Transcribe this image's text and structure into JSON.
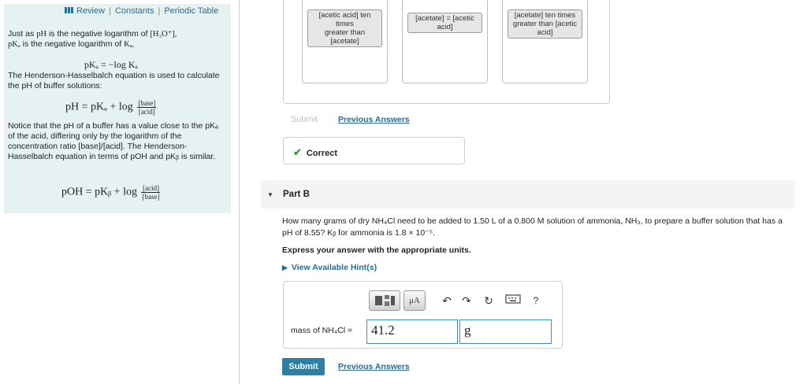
{
  "left_panel": {
    "links": {
      "review": "Review",
      "constants": "Constants",
      "periodic_table": "Periodic Table"
    },
    "para1_line1_a": "Just as",
    "para1_line1_b": "pH",
    "para1_line1_c": "is the negative logarithm of",
    "para1_line1_d": "[H₃O⁺],",
    "para1_line2_a": "pKₐ",
    "para1_line2_b": "is the negative logarithm of",
    "para1_line2_c": "Kₐ,",
    "eq1": "pKₐ = −log Kₐ",
    "para2": "The Henderson-Hasselbalch equation is used to calculate the pH of buffer solutions:",
    "eq2_lhs": "pH = pKₐ + log",
    "eq2_num": "[base]",
    "eq2_den": "[acid]",
    "para3": "Notice that the pH of a buffer has a value close to the pKₐ of the acid, differing only by the logarithm of the concentration ratio [base]/[acid]. The Henderson-Hasselbalch equation in terms of pOH and pKᵦ is similar.",
    "eq3_lhs": "pOH = pKᵦ + log",
    "eq3_num": "[acid]",
    "eq3_den": "[base]"
  },
  "part_a": {
    "cards": [
      {
        "chips": [
          "[acetic acid] ten times",
          "greater than [acetate]"
        ]
      },
      {
        "chips": [
          "[acetate] = [acetic acid]"
        ]
      },
      {
        "chips": [
          "[acetate] ten times greater than [acetic acid]"
        ]
      }
    ],
    "submit_label": "Submit",
    "previous_answers_label": "Previous Answers",
    "feedback": "Correct"
  },
  "part_b": {
    "title": "Part B",
    "question_line1": "How many grams of dry NH₄Cl need to be added to 1.50 L of a 0.800 M solution of ammonia, NH₃, to prepare a buffer solution that has a",
    "question_line2": "pH of 8.55? Kᵦ for ammonia is 1.8 × 10⁻⁵.",
    "instruction": "Express your answer with the appropriate units.",
    "hints_label": "View Available Hint(s)",
    "toolbar": {
      "units_label": "μA",
      "help_label": "?"
    },
    "answer_label": "mass of NH₄Cl =",
    "value": "41.2",
    "unit": "g",
    "submit_label": "Submit",
    "previous_answers_label": "Previous Answers"
  }
}
